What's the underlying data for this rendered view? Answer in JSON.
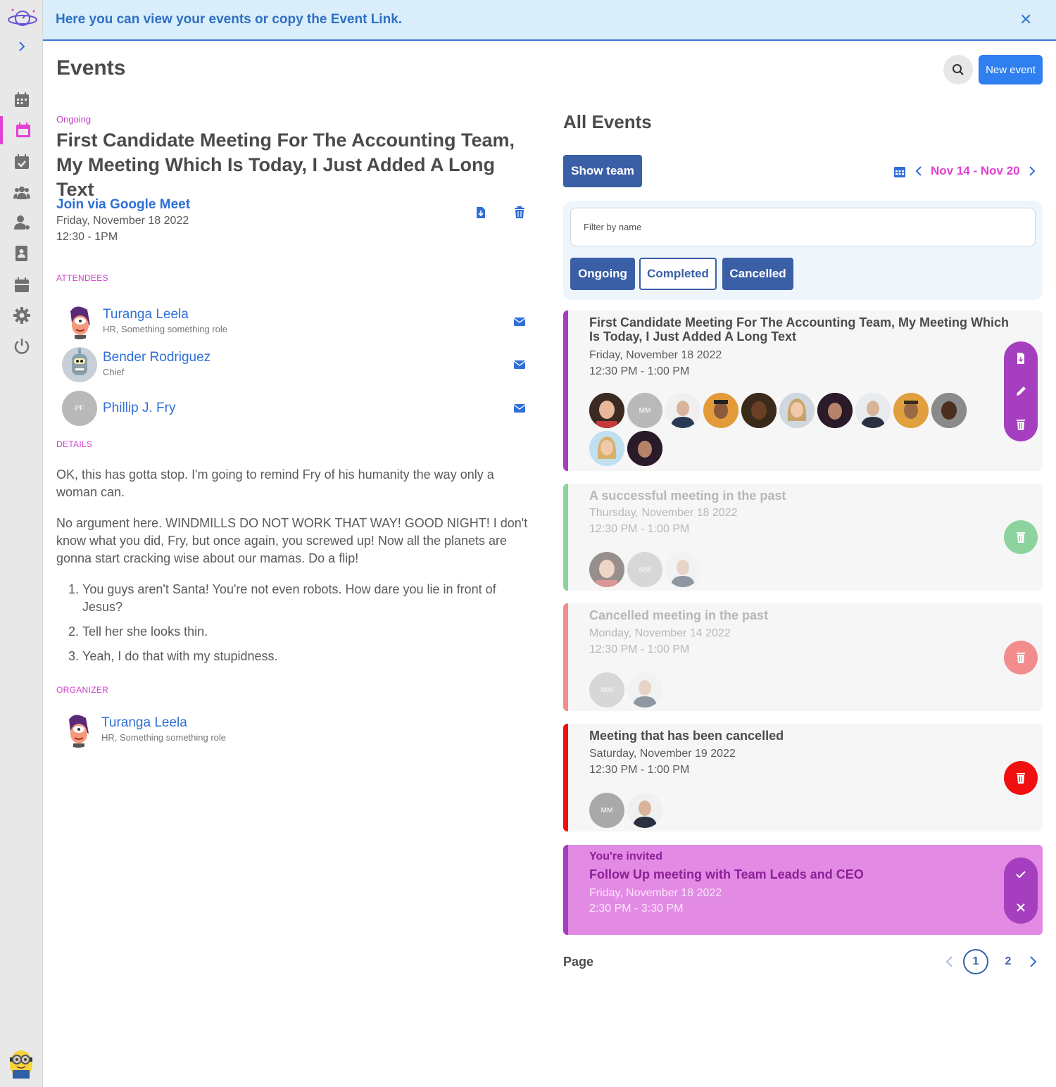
{
  "banner": {
    "text": "Here you can view your events or copy the Event Link.",
    "close": "✕"
  },
  "header": {
    "title": "Events",
    "new_event": "New event"
  },
  "detail": {
    "status": "Ongoing",
    "title": "First Candidate Meeting For The Accounting Team, My Meeting Which Is Today, I Just Added A Long Text",
    "join": "Join via Google Meet",
    "date": "Friday, November 18 2022",
    "time": "12:30 - 1PM",
    "attendees_label": "ATTENDEES",
    "attendees": [
      {
        "name": "Turanga Leela",
        "role": "HR, Something something role"
      },
      {
        "name": "Bender Rodriguez",
        "role": "Chief"
      },
      {
        "name": "Phillip J. Fry",
        "role": "",
        "initials": "PF"
      }
    ],
    "details_label": "DETAILS",
    "paragraphs": [
      "OK, this has gotta stop. I'm going to remind Fry of his humanity the way only a woman can.",
      "No argument here. WINDMILLS DO NOT WORK THAT WAY! GOOD NIGHT! I don't know what you did, Fry, but once again, you screwed up! Now all the planets are gonna start cracking wise about our mamas. Do a flip!"
    ],
    "list": [
      "You guys aren't Santa! You're not even robots. How dare you lie in front of Jesus?",
      "Tell her she looks thin.",
      "Yeah, I do that with my stupidness."
    ],
    "organizer_label": "ORGANIZER",
    "organizer": {
      "name": "Turanga Leela",
      "role": "HR, Something something role"
    }
  },
  "events_panel": {
    "title": "All Events",
    "show_team": "Show team",
    "week": "Nov 14 - Nov 20",
    "filter_placeholder": "Filter by name",
    "filters": [
      "Ongoing",
      "Completed",
      "Cancelled"
    ],
    "events": [
      {
        "title": "First Candidate Meeting For The Accounting Team, My Meeting Which Is Today, I Just Added A Long Text",
        "date": "Friday, November 18 2022",
        "time": "12:30 PM - 1:00 PM"
      },
      {
        "title": "A successful meeting in the past",
        "date": "Thursday, November 18 2022",
        "time": "12:30 PM - 1:00 PM"
      },
      {
        "title": "Cancelled meeting in the past",
        "date": "Monday, November 14 2022",
        "time": "12:30 PM - 1:00 PM"
      },
      {
        "title": "Meeting that has been cancelled",
        "date": "Saturday, November 19 2022",
        "time": "12:30 PM - 1:00 PM"
      }
    ],
    "avatar_initials": "MM",
    "invite": {
      "label": "You're invited",
      "title": "Follow Up meeting with Team Leads and CEO",
      "date": "Friday, November 18 2022",
      "time": "2:30 PM - 3:30 PM"
    },
    "page_label": "Page",
    "pages": [
      "1",
      "2"
    ]
  },
  "colors": {
    "accent_pink": "#e43fd3",
    "primary_blue": "#2f7ff0",
    "team_blue": "#3a5fa6",
    "completed_green": "#8dd39e",
    "cancelled_past": "#f38c8c",
    "cancelled_red": "#f01010",
    "invite_purple": "#a33fbf"
  }
}
